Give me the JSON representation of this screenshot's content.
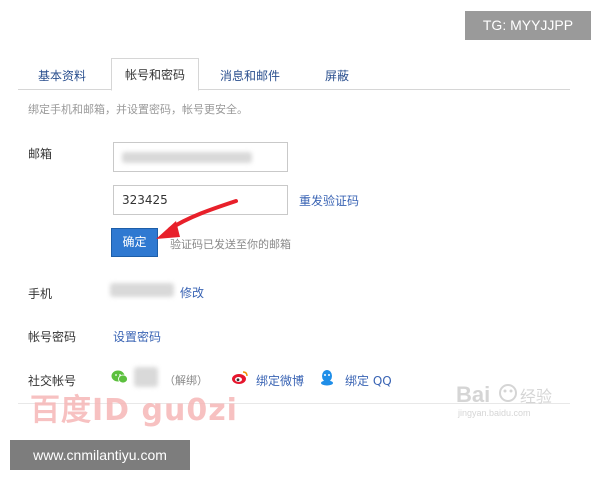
{
  "overlay": {
    "tg_handle": "TG: MYYJJPP",
    "site_url": "www.cnmilantiyu.com"
  },
  "tabs": [
    {
      "label": "基本资料",
      "active": false
    },
    {
      "label": "帐号和密码",
      "active": true
    },
    {
      "label": "消息和邮件",
      "active": false
    },
    {
      "label": "屏蔽",
      "active": false
    }
  ],
  "hint": "绑定手机和邮箱，并设置密码，帐号更安全。",
  "email": {
    "label": "邮箱",
    "code_value": "323425",
    "resend_label": "重发验证码",
    "confirm_label": "确定",
    "sent_notice": "验证码已发送至你的邮箱"
  },
  "phone": {
    "label": "手机",
    "edit_label": "修改"
  },
  "password": {
    "label": "帐号密码",
    "set_label": "设置密码"
  },
  "social": {
    "label": "社交帐号",
    "unbind_label": "（解绑）",
    "bind_weibo_label": "绑定微博",
    "bind_qq_label": "绑定 QQ"
  },
  "watermark": {
    "text": "百度ID gu0zi",
    "brand": "Bai",
    "brand_sub": "经验",
    "brand_url": "jingyan.baidu.com"
  },
  "colors": {
    "link": "#3a64b4",
    "button": "#2f79d1",
    "arrow": "#e8202a",
    "wechat": "#5cc03e",
    "weibo": "#e6162d",
    "qq": "#1f8ee8"
  }
}
